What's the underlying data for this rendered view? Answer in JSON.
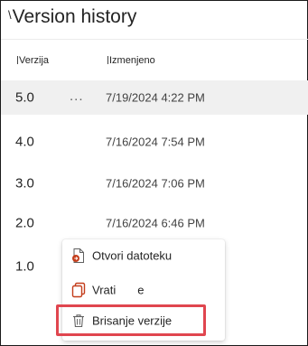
{
  "panel": {
    "title": "Version history",
    "title_mark": "\\"
  },
  "columns": {
    "version": "Verzija",
    "modified": "Izmenjeno"
  },
  "rows": [
    {
      "version": "5.0",
      "modified": "7/19/2024 4:22 PM",
      "selected": true,
      "more": "..."
    },
    {
      "version": "4.0",
      "modified": "7/16/2024 7:54 PM"
    },
    {
      "version": "3.0",
      "modified": "7/16/2024 7:06 PM"
    },
    {
      "version": "2.0",
      "modified": "7/16/2024 6:46 PM"
    },
    {
      "version": "1.0",
      "modified": ""
    }
  ],
  "context_menu": {
    "items": [
      {
        "label": "Otvori datoteku",
        "icon": "open-file-icon"
      },
      {
        "label": "Vrati",
        "trailing": "e",
        "icon": "restore-icon"
      },
      {
        "label": "Brisanje verzije",
        "icon": "trash-icon"
      }
    ]
  },
  "colors": {
    "highlight": "#e0464f",
    "selected_row": "#f0f0f0",
    "open_icon_accent": "#c43e1c"
  }
}
